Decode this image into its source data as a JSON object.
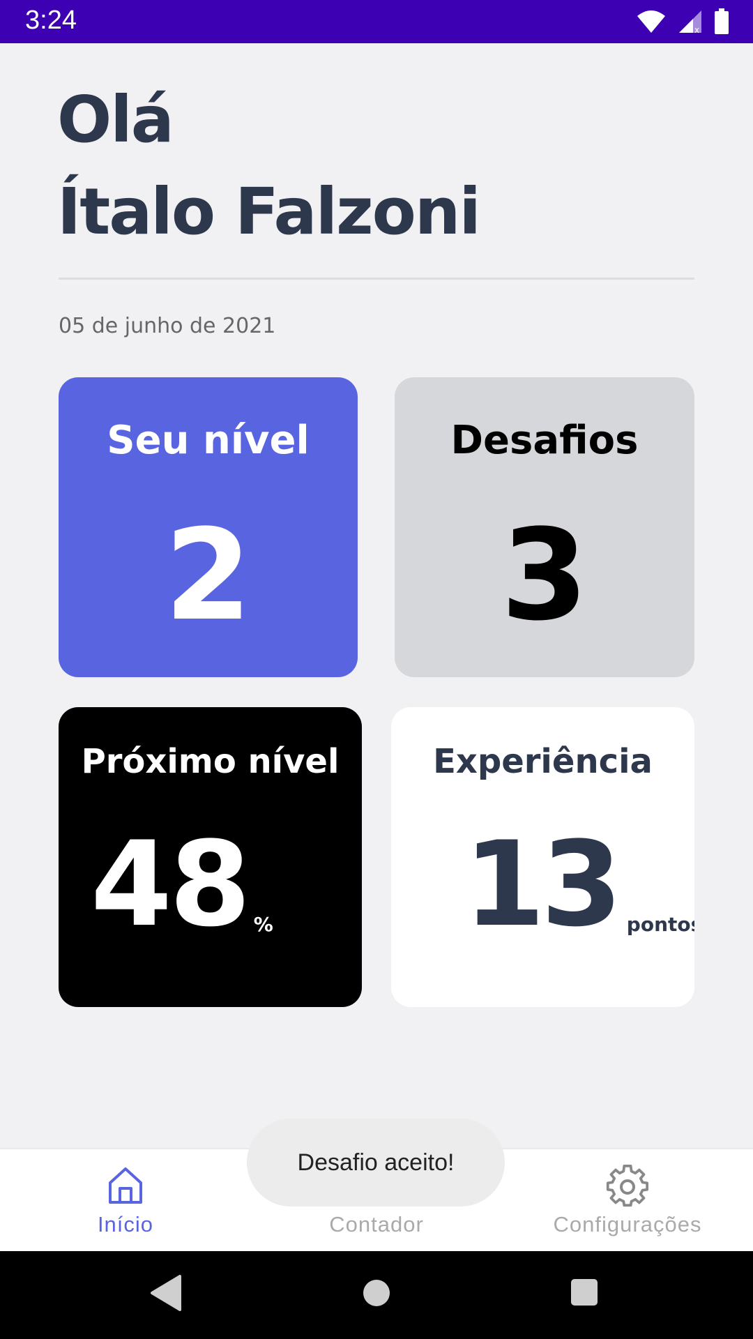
{
  "status_bar": {
    "time": "3:24",
    "background": "#3d00b3",
    "icons": [
      "wifi-icon",
      "signal-icon",
      "battery-icon"
    ]
  },
  "header": {
    "greeting": "Olá",
    "user_name": "Ítalo Falzoni",
    "date": "05 de junho de 2021"
  },
  "cards": {
    "level": {
      "title": "Seu nível",
      "value": "2",
      "color": "#5965e0"
    },
    "challenges": {
      "title": "Desafios",
      "value": "3",
      "color": "#d6d7da"
    },
    "next_level": {
      "title": "Próximo nível",
      "value": "48",
      "unit": "%",
      "color": "#000000"
    },
    "experience": {
      "title": "Experiência",
      "value": "13",
      "unit": "pontos",
      "color": "#ffffff"
    }
  },
  "bottom_nav": {
    "items": [
      {
        "label": "Início",
        "icon": "home-icon",
        "active": true
      },
      {
        "label": "Contador",
        "icon": "clock-icon",
        "active": false
      },
      {
        "label": "Configurações",
        "icon": "gear-icon",
        "active": false
      }
    ],
    "accent": "#5965e0"
  },
  "toast": {
    "message": "Desafio aceito!"
  },
  "system_nav": {
    "icons": [
      "back-icon",
      "home-circle-icon",
      "recent-apps-icon"
    ]
  }
}
